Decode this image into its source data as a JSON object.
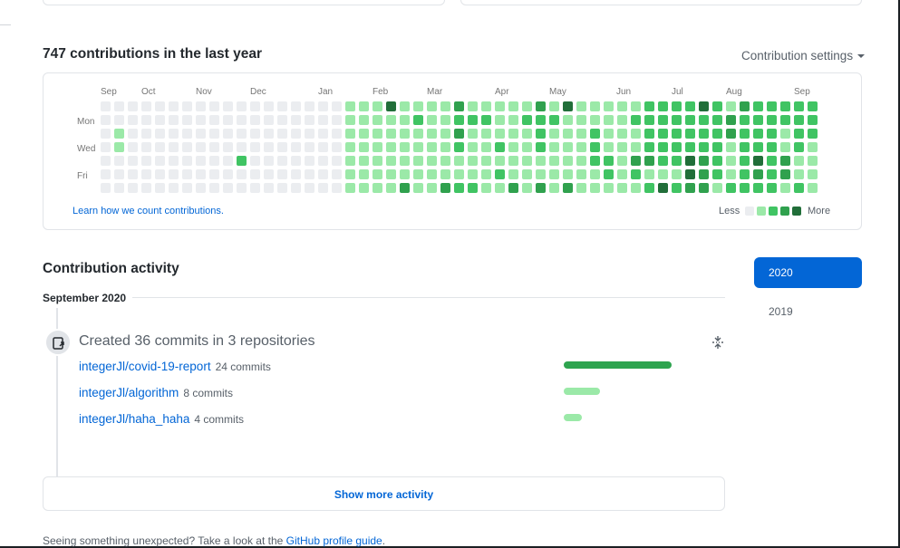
{
  "contributions": {
    "title": "747 contributions in the last year",
    "settings_label": "Contribution settings",
    "months": [
      "Sep",
      "Oct",
      "Nov",
      "Dec",
      "Jan",
      "Feb",
      "Mar",
      "Apr",
      "May",
      "Jun",
      "Jul",
      "Aug",
      "Sep"
    ],
    "weekday_labels": [
      "Mon",
      "Wed",
      "Fri"
    ],
    "learn_link": "Learn how we count contributions.",
    "legend_less": "Less",
    "legend_more": "More",
    "legend_colors": [
      "#ebedf0",
      "#9be9a8",
      "#40c463",
      "#30a14e",
      "#216e39"
    ],
    "levels_by_week": [
      "0000000",
      "0011000",
      "0000000",
      "0000000",
      "0000000",
      "0000000",
      "0000000",
      "0000000",
      "0000000",
      "0000000",
      "0000200",
      "0000000",
      "0000000",
      "0000000",
      "0000000",
      "0000000",
      "0000000",
      "0000000",
      "1111111",
      "1111111",
      "1111111",
      "4111111",
      "1111113",
      "1211111",
      "1111111",
      "1111113",
      "3232112",
      "1211112",
      "1211111",
      "1112121",
      "1111113",
      "1211111",
      "3222113",
      "1211111",
      "4111113",
      "1111111",
      "1122211",
      "1111221",
      "1111111",
      "1211321",
      "2222312",
      "2222214",
      "2222212",
      "2222443",
      "4222333",
      "2222221",
      "1331112",
      "3222222",
      "2222432",
      "2222222",
      "2211331",
      "2222112",
      "2221111"
    ]
  },
  "activity": {
    "title": "Contribution activity",
    "month_heading": "September 2020",
    "event_title": "Created 36 commits in 3 repositories",
    "repos": [
      {
        "name": "integerJl/covid-19-report",
        "count": "24 commits",
        "commits": 24,
        "color": "#2ea44f"
      },
      {
        "name": "integerJl/algorithm",
        "count": "8 commits",
        "commits": 8,
        "color": "#9be9a8"
      },
      {
        "name": "integerJl/haha_haha",
        "count": "4 commits",
        "commits": 4,
        "color": "#9be9a8"
      }
    ],
    "show_more": "Show more activity"
  },
  "years": {
    "active": "2020",
    "other": "2019"
  },
  "footer": {
    "text": "Seeing something unexpected? Take a look at the ",
    "link": "GitHub profile guide",
    "end": "."
  }
}
